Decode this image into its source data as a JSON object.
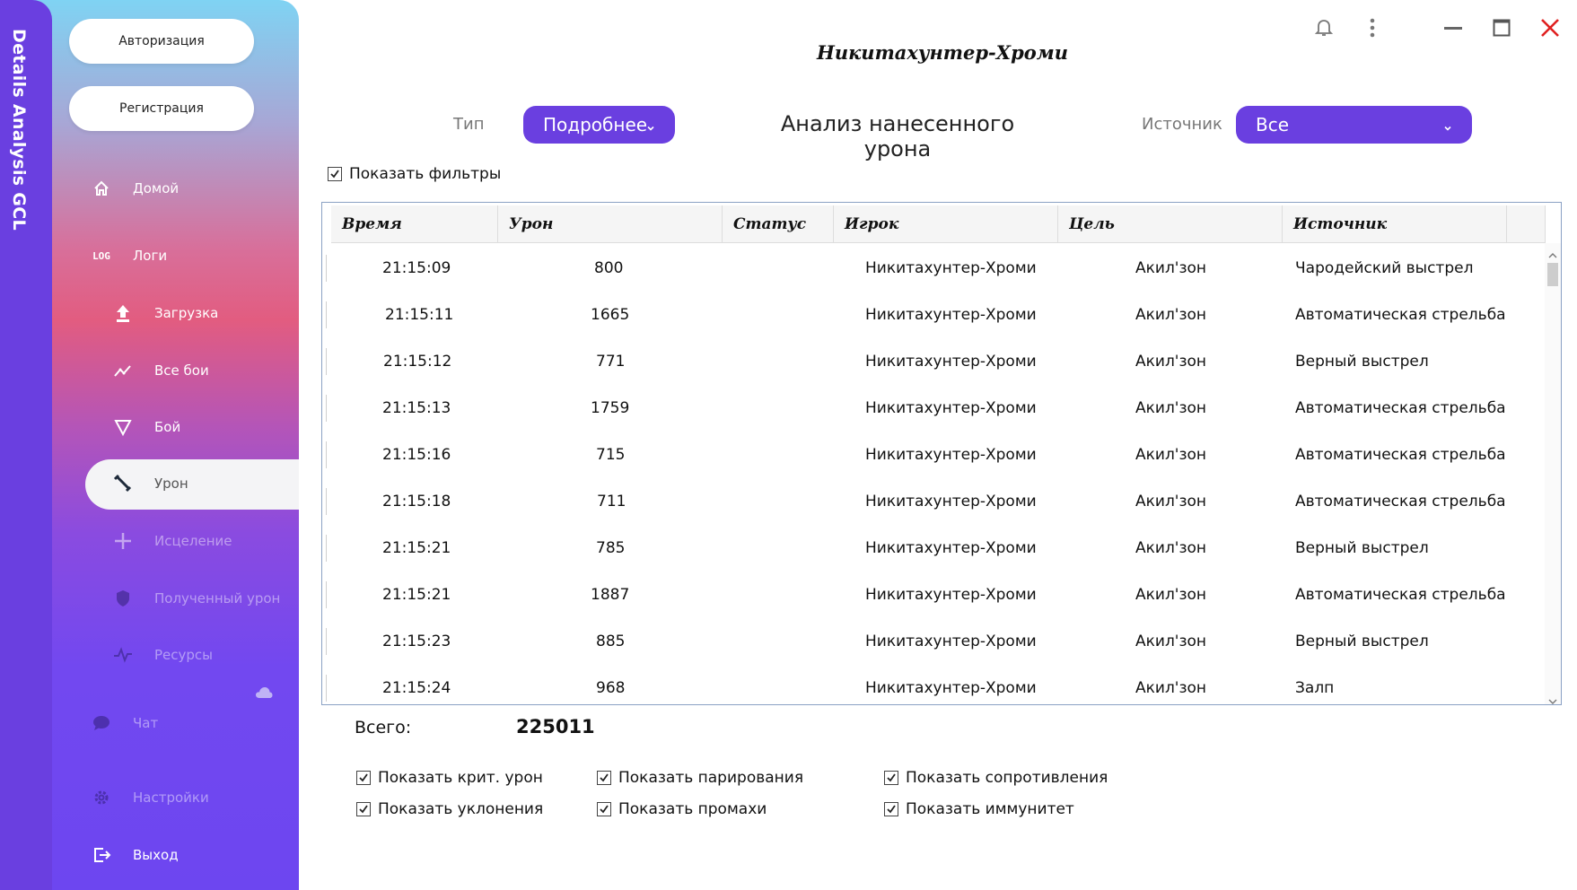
{
  "app": {
    "vertical_title": "Details Analysis GCL",
    "window_title": "Никитахунтер-Хроми"
  },
  "auth": {
    "login_label": "Авторизация",
    "register_label": "Регистрация"
  },
  "sidebar": {
    "home": "Домой",
    "logs_badge": "LOG",
    "logs": "Логи",
    "upload": "Загрузка",
    "all_fights": "Все бои",
    "fight": "Бой",
    "damage": "Урон",
    "healing": "Исцеление",
    "damage_taken": "Полученный урон",
    "resources": "Ресурсы",
    "chat": "Чат",
    "settings": "Настройки",
    "exit": "Выход"
  },
  "toolbar": {
    "type_label": "Тип",
    "type_value": "Подробнее",
    "section_title": "Анализ нанесенного урона",
    "source_label": "Источник",
    "source_value": "Все",
    "show_filters": "Показать фильтры",
    "show_filters_checked": true
  },
  "table": {
    "columns": [
      "Время",
      "Урон",
      "Статус",
      "Игрок",
      "Цель",
      "Источник"
    ],
    "rows": [
      {
        "time": "21:15:09",
        "damage": "800",
        "status": "",
        "player": "Никитахунтер-Хроми",
        "target": "Акил'зон",
        "source": "Чародейский выстрел"
      },
      {
        "time": "21:15:11",
        "damage": "1665",
        "status": "",
        "player": "Никитахунтер-Хроми",
        "target": "Акил'зон",
        "source": "Автоматическая стрельба"
      },
      {
        "time": "21:15:12",
        "damage": "771",
        "status": "",
        "player": "Никитахунтер-Хроми",
        "target": "Акил'зон",
        "source": "Верный выстрел"
      },
      {
        "time": "21:15:13",
        "damage": "1759",
        "status": "",
        "player": "Никитахунтер-Хроми",
        "target": "Акил'зон",
        "source": "Автоматическая стрельба"
      },
      {
        "time": "21:15:16",
        "damage": "715",
        "status": "",
        "player": "Никитахунтер-Хроми",
        "target": "Акил'зон",
        "source": "Автоматическая стрельба"
      },
      {
        "time": "21:15:18",
        "damage": "711",
        "status": "",
        "player": "Никитахунтер-Хроми",
        "target": "Акил'зон",
        "source": "Автоматическая стрельба"
      },
      {
        "time": "21:15:21",
        "damage": "785",
        "status": "",
        "player": "Никитахунтер-Хроми",
        "target": "Акил'зон",
        "source": "Верный выстрел"
      },
      {
        "time": "21:15:21",
        "damage": "1887",
        "status": "",
        "player": "Никитахунтер-Хроми",
        "target": "Акил'зон",
        "source": "Автоматическая стрельба"
      },
      {
        "time": "21:15:23",
        "damage": "885",
        "status": "",
        "player": "Никитахунтер-Хроми",
        "target": "Акил'зон",
        "source": "Верный выстрел"
      },
      {
        "time": "21:15:24",
        "damage": "968",
        "status": "",
        "player": "Никитахунтер-Хроми",
        "target": "Акил'зон",
        "source": "Залп"
      }
    ]
  },
  "summary": {
    "total_label": "Всего:",
    "total_value": "225011"
  },
  "filters": [
    {
      "label": "Показать крит. урон",
      "checked": true
    },
    {
      "label": "Показать парирования",
      "checked": true
    },
    {
      "label": "Показать сопротивления",
      "checked": true
    },
    {
      "label": "Показать уклонения",
      "checked": true
    },
    {
      "label": "Показать промахи",
      "checked": true
    },
    {
      "label": "Показать иммунитет",
      "checked": true
    }
  ],
  "colors": {
    "accent": "#6a3fe0",
    "close": "#e02020"
  }
}
